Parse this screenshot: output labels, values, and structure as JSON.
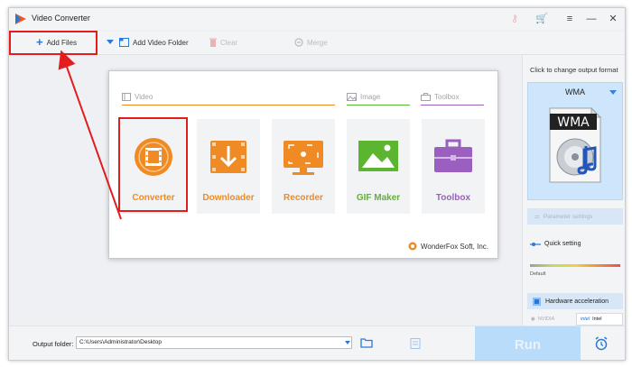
{
  "app": {
    "title": "Video Converter"
  },
  "toolbar": {
    "add_files": "Add Files",
    "add_video_folder": "Add Video Folder",
    "clear": "Clear",
    "merge": "Merge"
  },
  "right_panel": {
    "caption": "Click to change output format",
    "format": "WMA",
    "format_image_text": "WMA",
    "parameter_settings": "Parameter settings",
    "quick_setting": "Quick setting",
    "quality_default": "Default",
    "hardware_acceleration": "Hardware acceleration",
    "vendor_nvidia": "NVIDIA",
    "vendor_intel": "Intel"
  },
  "dialog": {
    "sections": {
      "video": "Video",
      "image": "Image",
      "toolbox": "Toolbox"
    },
    "tiles": [
      {
        "label": "Converter",
        "color": "#f08a24"
      },
      {
        "label": "Downloader",
        "color": "#f08a24"
      },
      {
        "label": "Recorder",
        "color": "#f08a24"
      },
      {
        "label": "GIF Maker",
        "color": "#5cb531"
      },
      {
        "label": "Toolbox",
        "color": "#9b5fc0"
      }
    ],
    "brand": "WonderFox Soft, Inc."
  },
  "bottom": {
    "output_folder_label": "Output folder:",
    "output_folder_value": "C:\\Users\\Administrator\\Desktop",
    "run": "Run"
  },
  "colors": {
    "accent": "#2979d9",
    "highlight": "#e11d1d",
    "orange": "#f08a24",
    "green": "#5cb531",
    "purple": "#9b5fc0",
    "run_bg": "#b9dcfa"
  }
}
